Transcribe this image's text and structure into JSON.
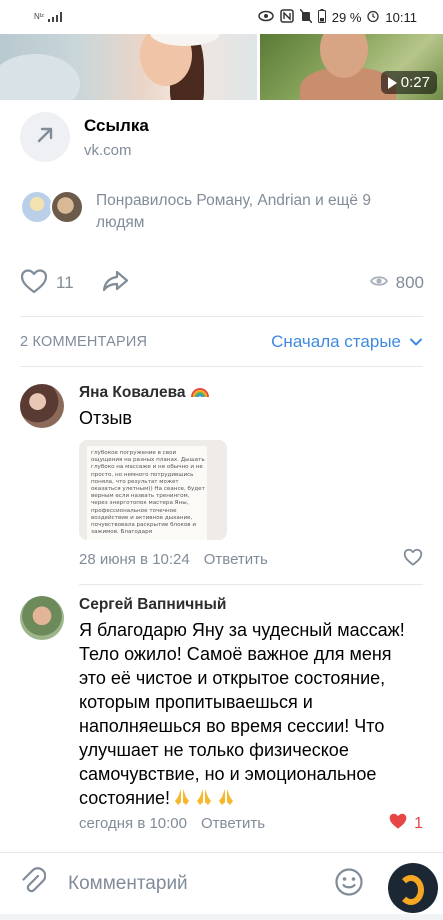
{
  "status_bar": {
    "carrier": "Nᴵᶻ",
    "battery": "29 %",
    "time": "10:11"
  },
  "media": {
    "video_duration": "0:27"
  },
  "link": {
    "title": "Ссылка",
    "domain": "vk.com"
  },
  "likes_summary": "Понравилось Роману, Andrian и ещё 9 людям",
  "actions": {
    "like_count": "11",
    "views": "800"
  },
  "comments": {
    "count_label": "2 КОММЕНТАРИЯ",
    "sort_label": "Сначала старые",
    "items": [
      {
        "author": "Яна Ковалева",
        "text": "Отзыв",
        "attachment_text": "глубокое погружение в свои ощущения на разных планах. Дышать глубоко на массаже и не обычно и не просто, но немного потрудившись поняла, что результат может оказаться улетным)) На сеансе, будет верным если назвать тренингом, через энерготопок мастера Яны, профессиональное точечное воздействие и активное дыхание, почувствовала раскрытие блоков и зажимов. Благодаря",
        "date": "28 июня в 10:24",
        "reply": "Ответить"
      },
      {
        "author": "Сергей Вапничный",
        "text": "Я благодарю Яну за чудесный массаж! Тело ожило! Самоё важное для меня это её чистое и открытое состояние, которым пропитываешься и наполняешься во время сессии! Что улучшает не только физическое самочувствие, но и эмоциональное состояние!",
        "date": "сегодня в 10:00",
        "reply": "Ответить",
        "likes": "1"
      }
    ]
  },
  "input": {
    "placeholder": "Комментарий"
  },
  "colors": {
    "accent": "#3f8ae0",
    "secondary_text": "#818c99",
    "like_red": "#e64646"
  }
}
